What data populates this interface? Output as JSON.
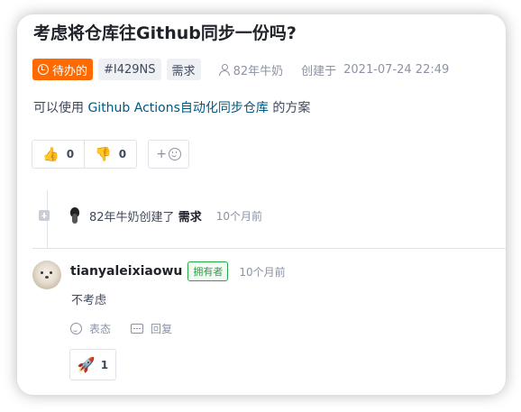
{
  "issue": {
    "title": "考虑将仓库往Github同步一份吗?",
    "status_label": "待办的",
    "issue_id": "#I429NS",
    "type_label": "需求",
    "author": "82年牛奶",
    "created_label": "创建于",
    "created_at": "2021-07-24 22:49",
    "body_prefix": "可以使用 ",
    "body_link": "Github Actions自动化同步仓库",
    "body_suffix": " 的方案"
  },
  "reactions": {
    "thumbs_up_count": "0",
    "thumbs_down_count": "0",
    "add_label": "+"
  },
  "timeline": {
    "event_text": "82年牛奶创建了",
    "event_type": "需求",
    "event_time": "10个月前"
  },
  "comment": {
    "user": "tianyaleixiaowu",
    "badge": "拥有者",
    "time": "10个月前",
    "body": "不考虑",
    "react_label": "表态",
    "reply_label": "回复",
    "rocket_count": "1"
  },
  "colors": {
    "status_orange": "#ff6a00",
    "link_blue": "#005980",
    "owner_green": "#27a744"
  }
}
